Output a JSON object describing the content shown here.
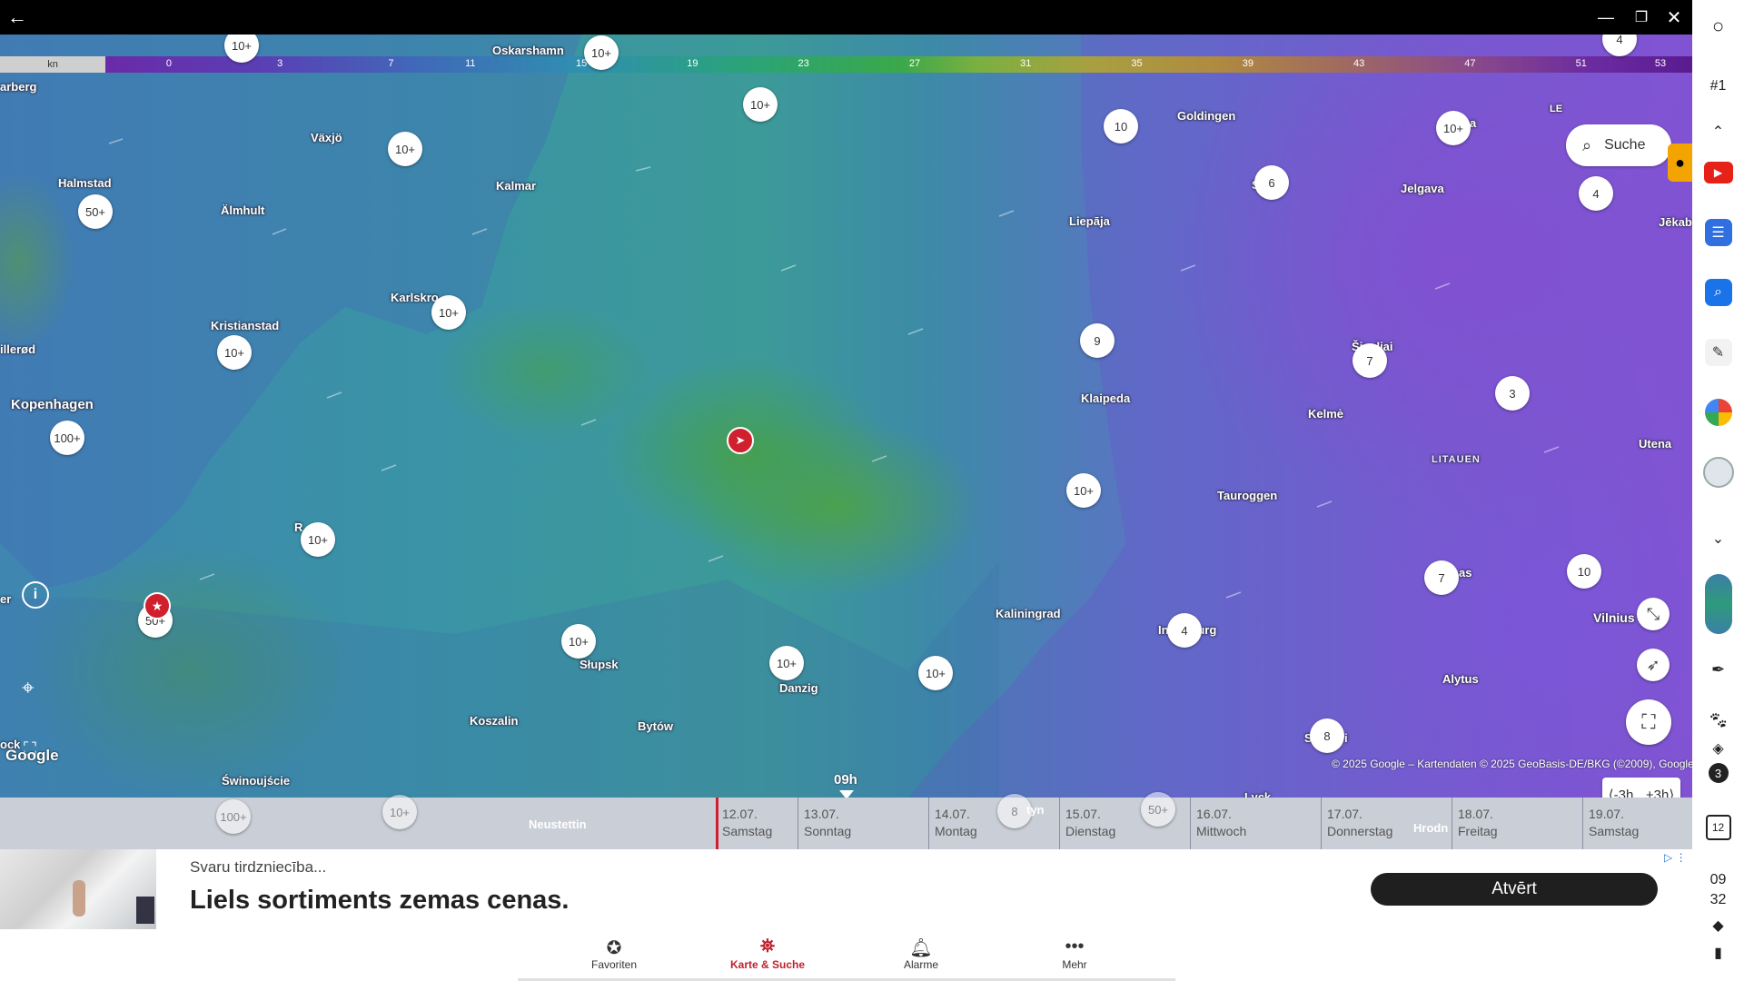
{
  "window": {
    "back_icon": "arrow-left-icon",
    "minimize_icon": "minimize-icon",
    "restore_icon": "restore-icon",
    "close_icon": "close-icon"
  },
  "scale": {
    "unit": "kn",
    "ticks": [
      "0",
      "3",
      "7",
      "11",
      "15",
      "19",
      "23",
      "27",
      "31",
      "35",
      "39",
      "43",
      "47",
      "51",
      "53"
    ]
  },
  "cities": [
    {
      "name": "Oskarshamn"
    },
    {
      "name": "arberg"
    },
    {
      "name": "Växjö"
    },
    {
      "name": "Halmstad"
    },
    {
      "name": "Älmhult"
    },
    {
      "name": "Kalmar"
    },
    {
      "name": "Karlskro"
    },
    {
      "name": "Kristianstad"
    },
    {
      "name": "illerød"
    },
    {
      "name": "Kopenhagen"
    },
    {
      "name": "Goldingen"
    },
    {
      "name": "Liepāja"
    },
    {
      "name": "Jelgava"
    },
    {
      "name": "Jēkab"
    },
    {
      "name": "Šiauliai"
    },
    {
      "name": "Klaipeda"
    },
    {
      "name": "Kelmė"
    },
    {
      "name": "LITAUEN"
    },
    {
      "name": "Utena"
    },
    {
      "name": "Tauroggen"
    },
    {
      "name": "Kaliningrad"
    },
    {
      "name": "Vilnius"
    },
    {
      "name": "Alytus"
    },
    {
      "name": "Słupsk"
    },
    {
      "name": "Danzig"
    },
    {
      "name": "Koszalin"
    },
    {
      "name": "Bytów"
    },
    {
      "name": "Świnoujście"
    },
    {
      "name": "Neustettin"
    },
    {
      "name": "Lyck"
    },
    {
      "name": "Hrodn"
    },
    {
      "name": "Insterburg"
    },
    {
      "name": "er"
    },
    {
      "name": "ock"
    },
    {
      "name": "R"
    },
    {
      "name": "LE"
    },
    {
      "name": "S"
    },
    {
      "name": "ga"
    },
    {
      "name": "S"
    },
    {
      "name": "i"
    },
    {
      "name": "as"
    },
    {
      "name": "tyn"
    }
  ],
  "clusters": [
    "10+",
    "10+",
    "10+",
    "10+",
    "50+",
    "10+",
    "10+",
    "10+",
    "100+",
    "10+",
    "50+",
    "10+",
    "10+",
    "10+",
    "10",
    "10+",
    "6",
    "4",
    "4",
    "9",
    "7",
    "3",
    "10+",
    "7",
    "10",
    "4",
    "8",
    "100+",
    "10+",
    "8",
    "50+"
  ],
  "search": {
    "label": "Suche",
    "icon": "search-icon"
  },
  "google_logo": "Google",
  "attribution": "© 2025 Google – Kartendaten © 2025 GeoBasis-DE/BKG (©2009), Google",
  "time_marker": "09h",
  "time_shift": {
    "minus": "-3h",
    "plus": "+3h"
  },
  "days": [
    {
      "date": "12.07.",
      "weekday": "Samstag"
    },
    {
      "date": "13.07.",
      "weekday": "Sonntag"
    },
    {
      "date": "14.07.",
      "weekday": "Montag"
    },
    {
      "date": "15.07.",
      "weekday": "Dienstag"
    },
    {
      "date": "16.07.",
      "weekday": "Mittwoch"
    },
    {
      "date": "17.07.",
      "weekday": "Donnerstag"
    },
    {
      "date": "18.07.",
      "weekday": "Freitag"
    },
    {
      "date": "19.07.",
      "weekday": "Samstag"
    }
  ],
  "ad": {
    "subtitle": "Svaru tirdzniecība...",
    "headline": "Liels sortiments zemas cenas.",
    "button": "Atvērt"
  },
  "nav": [
    {
      "label": "Favoriten",
      "icon": "star-badge-icon"
    },
    {
      "label": "Karte & Suche",
      "icon": "map-search-icon"
    },
    {
      "label": "Alarme",
      "icon": "bell-icon"
    },
    {
      "label": "Mehr",
      "icon": "more-dots-icon"
    }
  ],
  "sidebar": {
    "tag": "#1",
    "badge_count": "3",
    "calendar_day": "12",
    "clock_hour": "09",
    "clock_min": "32"
  },
  "colors": {
    "accent": "#d0202e",
    "nav_active": "#c0202e"
  }
}
